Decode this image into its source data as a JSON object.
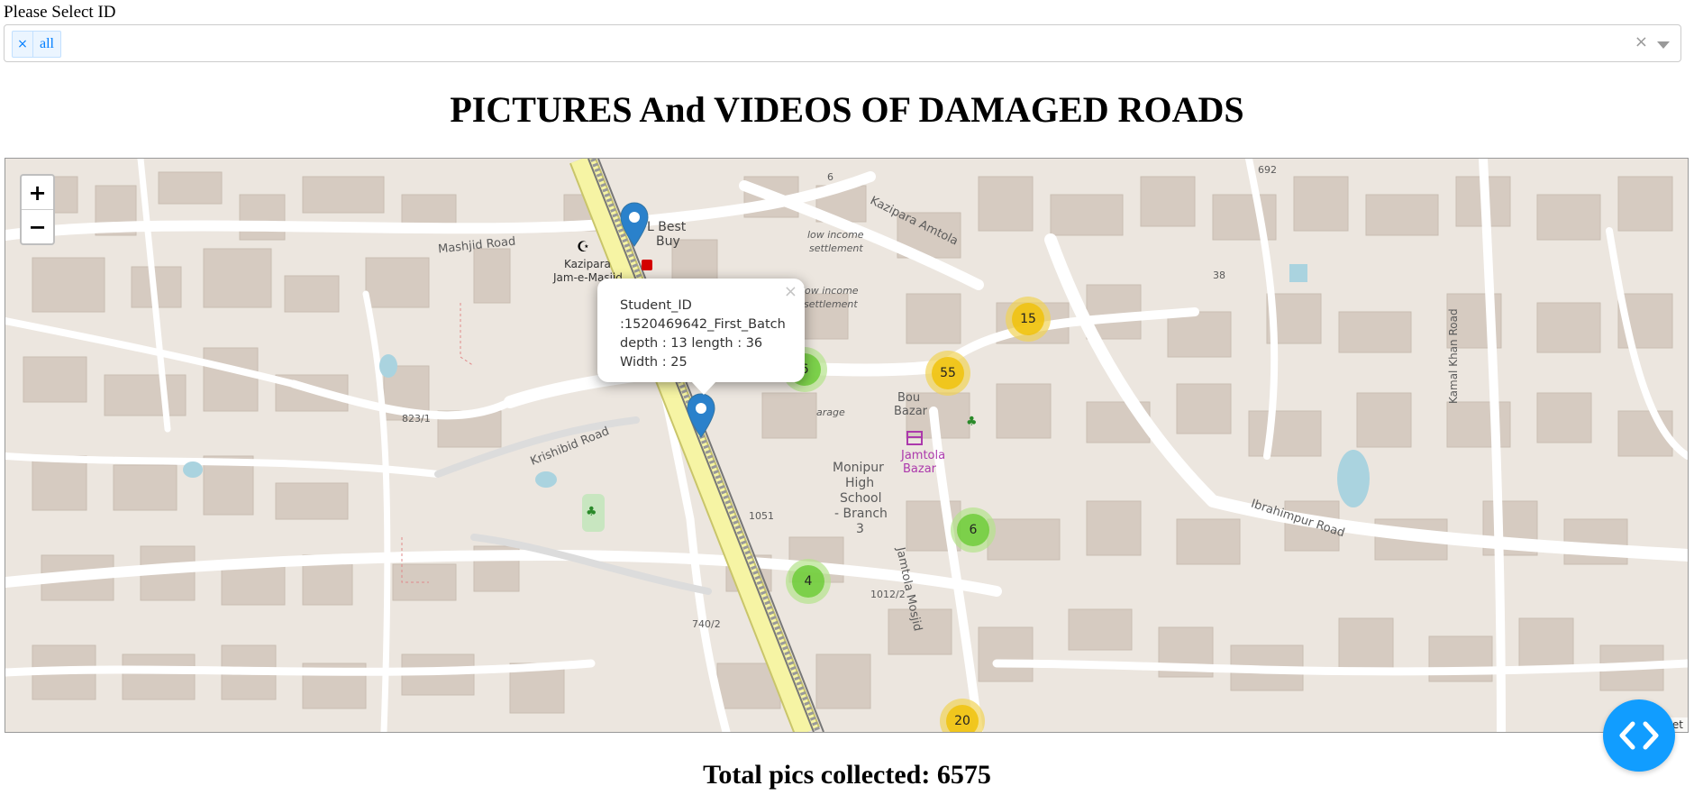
{
  "select": {
    "label": "Please Select ID",
    "tag_remove": "×",
    "selected_value": "all",
    "clear": "×"
  },
  "title": "PICTURES And VIDEOS OF DAMAGED ROADS",
  "map": {
    "zoom_in": "+",
    "zoom_out": "−",
    "clusters": [
      {
        "count": "15",
        "color": "yellow"
      },
      {
        "count": "6",
        "color": "green"
      },
      {
        "count": "55",
        "color": "yellow"
      },
      {
        "count": "6",
        "color": "green"
      },
      {
        "count": "4",
        "color": "green"
      },
      {
        "count": "20",
        "color": "yellow"
      }
    ],
    "popup": {
      "close": "×",
      "line1": "Student_ID",
      "line2": ":1520469642_First_Batch",
      "line3": "depth : 13 length : 36",
      "line4": "Width : 25"
    },
    "labels": {
      "mashjid_road": "Mashjid Road",
      "kazipara_amtola": "Kazipara Amtola",
      "krishibid_road": "Krishibid Road",
      "ibrahimpur_road": "Ibrahimpur Road",
      "kamal_khan_road": "Kamal Khan Road",
      "jamtola_mosjid": "Jamtola Mosjid",
      "best_buy_1": "L Best",
      "best_buy_2": "Buy",
      "kazipara_1": "Kazipara",
      "kazipara_2": "Jam-e-Masjid",
      "low_income_1": "low income",
      "low_income_2": "settlement",
      "low_income_3": "low income",
      "low_income_4": "settlement",
      "bou_1": "Bou",
      "bou_2": "Bazar",
      "jamtola_1": "Jamtola",
      "jamtola_2": "Bazar",
      "monipur_1": "Monipur",
      "monipur_2": "High",
      "monipur_3": "School",
      "monipur_4": "- Branch",
      "monipur_5": "3",
      "num_692": "692",
      "num_38": "38",
      "num_823": "823/1",
      "num_1051": "1051",
      "num_1012": "1012/2",
      "num_740": "740/2",
      "num_6": "6",
      "garage": "arage",
      "attribution": "let"
    },
    "colors": {
      "cluster_green": "#6ecc39",
      "cluster_yellow": "#f0c20c",
      "marker": "#2a81cb",
      "railway": "#f6f4a4"
    }
  },
  "footer": "Total pics collected: 6575",
  "fab_icon": "code-brackets-icon"
}
